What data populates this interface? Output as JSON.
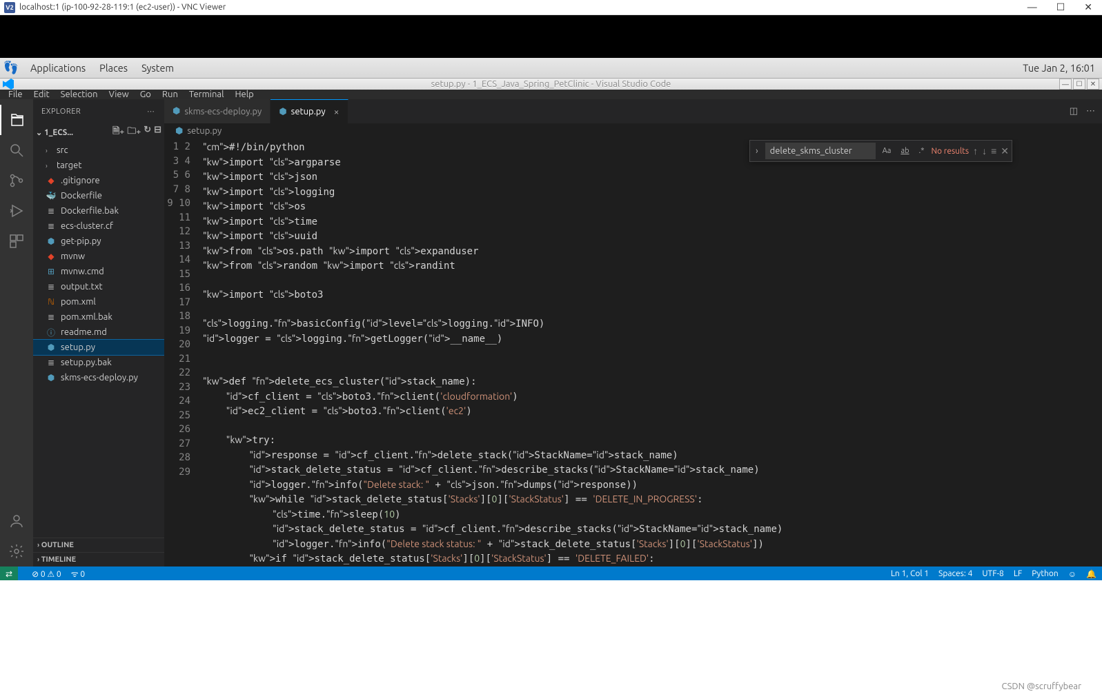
{
  "vnc": {
    "title": "localhost:1 (ip-100-92-28-119:1 (ec2-user)) - VNC Viewer",
    "logo": "V2"
  },
  "gnome": {
    "menus": [
      "Applications",
      "Places",
      "System"
    ],
    "clock": "Tue Jan  2, 16:01"
  },
  "vscode_title": "setup.py - 1_ECS_Java_Spring_PetClinic - Visual Studio Code",
  "menubar": [
    "File",
    "Edit",
    "Selection",
    "View",
    "Go",
    "Run",
    "Terminal",
    "Help"
  ],
  "explorer": {
    "label": "EXPLORER",
    "project": "1_ECS...",
    "items": [
      {
        "type": "dir",
        "label": "src"
      },
      {
        "type": "dir",
        "label": "target"
      },
      {
        "type": "git",
        "label": ".gitignore"
      },
      {
        "type": "docker",
        "label": "Dockerfile"
      },
      {
        "type": "file",
        "label": "Dockerfile.bak"
      },
      {
        "type": "file",
        "label": "ecs-cluster.cf"
      },
      {
        "type": "py",
        "label": "get-pip.py"
      },
      {
        "type": "mvn",
        "label": "mvnw"
      },
      {
        "type": "cmd",
        "label": "mvnw.cmd"
      },
      {
        "type": "file",
        "label": "output.txt"
      },
      {
        "type": "xml",
        "label": "pom.xml"
      },
      {
        "type": "file",
        "label": "pom.xml.bak"
      },
      {
        "type": "md",
        "label": "readme.md"
      },
      {
        "type": "py",
        "label": "setup.py",
        "selected": true
      },
      {
        "type": "file",
        "label": "setup.py.bak"
      },
      {
        "type": "py",
        "label": "skms-ecs-deploy.py"
      }
    ],
    "outline": "OUTLINE",
    "timeline": "TIMELINE"
  },
  "tabs": [
    {
      "label": "skms-ecs-deploy.py",
      "active": false
    },
    {
      "label": "setup.py",
      "active": true
    }
  ],
  "breadcrumb": "setup.py",
  "find": {
    "query": "delete_skms_cluster",
    "result": "No results"
  },
  "status": {
    "errors": "0",
    "warnings": "0",
    "ports": "0",
    "cursor": "Ln 1, Col 1",
    "spaces": "Spaces: 4",
    "enc": "UTF-8",
    "eol": "LF",
    "lang": "Python"
  },
  "watermark": "CSDN @scruffybear",
  "code_lines": [
    "#!/bin/python",
    "import argparse",
    "import json",
    "import logging",
    "import os",
    "import time",
    "import uuid",
    "from os.path import expanduser",
    "from random import randint",
    "",
    "import boto3",
    "",
    "logging.basicConfig(level=logging.INFO)",
    "logger = logging.getLogger(__name__)",
    "",
    "",
    "def delete_ecs_cluster(stack_name):",
    "    cf_client = boto3.client('cloudformation')",
    "    ec2_client = boto3.client('ec2')",
    "",
    "    try:",
    "        response = cf_client.delete_stack(StackName=stack_name)",
    "        stack_delete_status = cf_client.describe_stacks(StackName=stack_name)",
    "        logger.info(\"Delete stack: \" + json.dumps(response))",
    "        while stack_delete_status['Stacks'][0]['StackStatus'] == 'DELETE_IN_PROGRESS':",
    "            time.sleep(10)",
    "            stack_delete_status = cf_client.describe_stacks(StackName=stack_name)",
    "            logger.info(\"Delete stack status: \" + stack_delete_status['Stacks'][0]['StackStatus'])",
    "        if stack_delete_status['Stacks'][0]['StackStatus'] == 'DELETE_FAILED':"
  ]
}
